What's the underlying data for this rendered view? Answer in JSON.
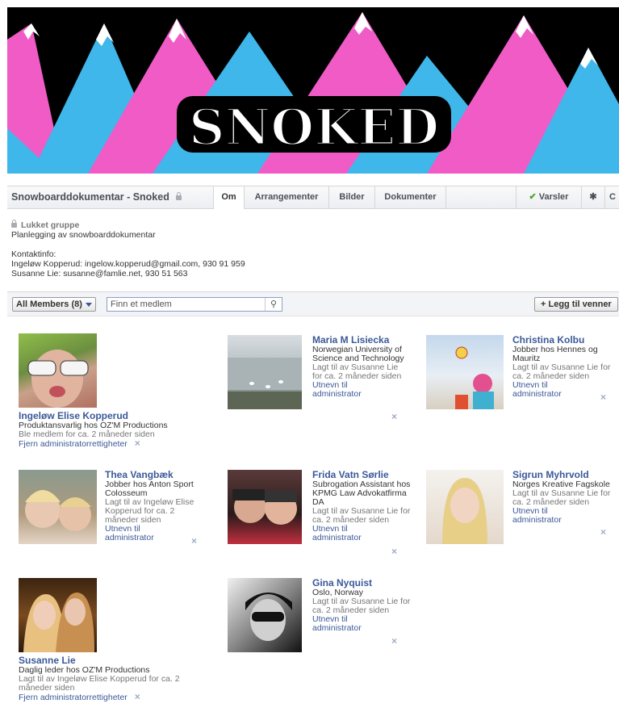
{
  "banner": {
    "title": "SNOKED"
  },
  "group": {
    "name": "Snowboarddokumentar - Snoked",
    "tabs": [
      "Om",
      "Arrangementer",
      "Bilder",
      "Dokumenter"
    ],
    "notifications": "Varsler",
    "right_trailing": "C"
  },
  "about": {
    "privacy": "Lukket gruppe",
    "description": "Planlegging av snowboarddokumentar",
    "contact_heading": "Kontaktinfo:",
    "contact_1": "Ingeløw Kopperud: ingelow.kopperud@gmail.com, 930 91 959",
    "contact_2": "Susanne Lie: susanne@famlie.net, 930 51 563"
  },
  "toolbar": {
    "filter": "All Members (8)",
    "search_placeholder": "Finn et medlem",
    "add_friends": "+ Legg til venner"
  },
  "members": [
    {
      "name": "Ingeløw Elise Kopperud",
      "desc": "Produktansvarlig hos OZ'M Productions",
      "added": "Ble medlem for ca. 2 måneder siden",
      "action": "Fjern administratorrettigheter"
    },
    {
      "name": "Maria M Lisiecka",
      "desc": "Norwegian University of Science and Technology",
      "added": "Lagt til av Susanne Lie for ca. 2 måneder siden",
      "action": "Utnevn til administrator"
    },
    {
      "name": "Christina Kolbu",
      "desc": "Jobber hos Hennes og Mauritz",
      "added": "Lagt til av Susanne Lie for ca. 2 måneder siden",
      "action": "Utnevn til administrator"
    },
    {
      "name": "Thea Vangbæk",
      "desc": "Jobber hos Anton Sport Colosseum",
      "added": "Lagt til av Ingeløw Elise Kopperud for ca. 2 måneder siden",
      "action": "Utnevn til administrator"
    },
    {
      "name": "Frida Vatn Sørlie",
      "desc": "Subrogation Assistant hos KPMG Law Advokatfirma DA",
      "added": "Lagt til av Susanne Lie for ca. 2 måneder siden",
      "action": "Utnevn til administrator"
    },
    {
      "name": "Sigrun Myhrvold",
      "desc": "Norges Kreative Fagskole",
      "added": "Lagt til av Susanne Lie for ca. 2 måneder siden",
      "action": "Utnevn til administrator"
    },
    {
      "name": "Gina Nyquist",
      "desc": "Oslo, Norway",
      "added": "Lagt til av Susanne Lie for ca. 2 måneder siden",
      "action": "Utnevn til administrator"
    },
    {
      "name": "Susanne Lie",
      "desc": "Daglig leder hos OZ'M Productions",
      "added": "Lagt til av Ingeløw Elise Kopperud for ca. 2 måneder siden",
      "action": "Fjern administratorrettigheter"
    }
  ],
  "icons": {
    "remove": "×",
    "search": "search-icon",
    "settings": "gear-icon",
    "lock": "lock-icon"
  }
}
